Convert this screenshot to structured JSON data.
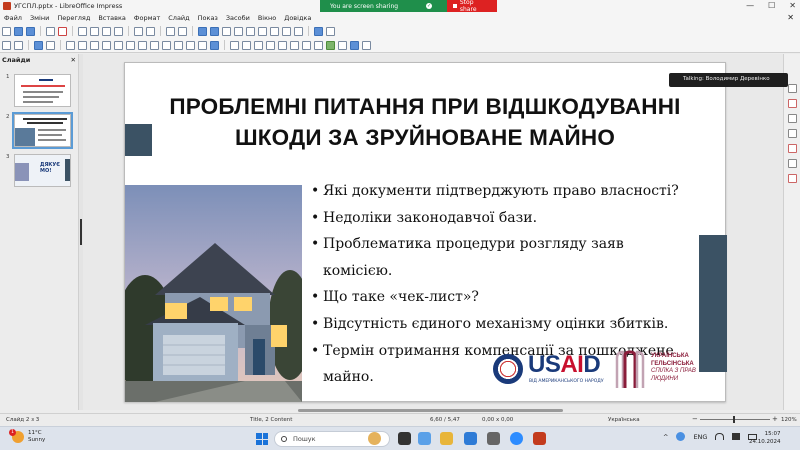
{
  "window": {
    "title": "УГСПЛ.pptx - LibreOffice Impress",
    "controls": {
      "minimize": "—",
      "maximize": "☐",
      "close": "✕"
    }
  },
  "screen_share": {
    "message": "You are screen sharing",
    "stop_label": "Stop share"
  },
  "menu": {
    "items": [
      "Файл",
      "Зміни",
      "Перегляд",
      "Вставка",
      "Формат",
      "Слайд",
      "Показ",
      "Засоби",
      "Вікно",
      "Довідка"
    ],
    "close_doc": "✕"
  },
  "slides_pane": {
    "header": "Слайди",
    "close": "✕",
    "thumbs": [
      {
        "num": "1"
      },
      {
        "num": "2"
      },
      {
        "num": "3",
        "text": "ДЯКУЄ\nМО!"
      }
    ]
  },
  "slide": {
    "title_line1": "ПРОБЛЕМНІ ПИТАННЯ ПРИ ВІДШКОДУВАННІ",
    "title_line2": "ШКОДИ ЗА ЗРУЙНОВАНЕ МАЙНО",
    "bullets": [
      "Які документи підтверджують право власності?",
      "Недоліки законодавчої бази.",
      "Проблематика процедури розгляду заяв комісією.",
      "Що таке «чек-лист»?",
      "Відсутність єдиного механізму оцінки збитків.",
      "Термін отримання компенсації за пошкоджене майно."
    ],
    "usaid": {
      "part1": "US",
      "part2": "AI",
      "part3": "D",
      "sub": "ВІД АМЕРИКАНСЬКОГО НАРОДУ"
    },
    "uhhrl": {
      "line1": "УКРАЇНСЬКА",
      "line2": "ГЕЛЬСІНСЬКА",
      "line3": "СПІЛКА З ПРАВ",
      "line4": "ЛЮДИНИ"
    }
  },
  "talking_indicator": "Talking: Володимир Деревінко",
  "status": {
    "slide": "Слайд 2 з 3",
    "layout": "Title, 2 Content",
    "position": "6,60 / 5,47",
    "size": "0,00 x 0,00",
    "language": "Українська",
    "zoom_minus": "−",
    "zoom_plus": "+",
    "zoom": "120%"
  },
  "taskbar": {
    "weather_badge": "1",
    "temperature": "11°C",
    "condition": "Sunny",
    "search_placeholder": "Пошук",
    "tray": {
      "up": "^",
      "lang": "ENG"
    },
    "time": "15:07",
    "date": "24.10.2024"
  },
  "colors": {
    "slide_accent": "#3b5264",
    "usaid_blue": "#1a3a7a",
    "usaid_red": "#c8102e",
    "share_green": "#1f8f4b",
    "stop_red": "#dd2222"
  }
}
